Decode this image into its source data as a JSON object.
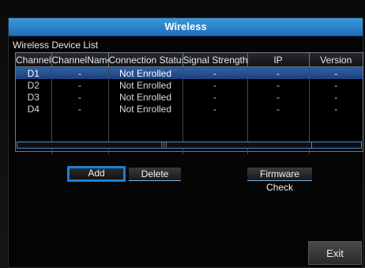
{
  "window": {
    "title": "Wireless"
  },
  "device_list": {
    "label": "Wireless Device List",
    "columns": [
      "Channel",
      "ChannelName",
      "Connection Status",
      "Signal Strength",
      "IP",
      "Version"
    ],
    "rows": [
      [
        "D1",
        "-",
        "Not Enrolled",
        "-",
        "-",
        "-"
      ],
      [
        "D2",
        "-",
        "Not Enrolled",
        "-",
        "-",
        "-"
      ],
      [
        "D3",
        "-",
        "Not Enrolled",
        "-",
        "-",
        "-"
      ],
      [
        "D4",
        "-",
        "Not Enrolled",
        "-",
        "-",
        "-"
      ]
    ],
    "selected_row": 0,
    "scroll_grip": "|||"
  },
  "buttons": {
    "add": "Add",
    "delete": "Delete",
    "firmware": "Firmware Check",
    "exit": "Exit"
  },
  "colors": {
    "accent": "#1a7fd8",
    "title_bar": "#2a86cc",
    "selection": "#2a5597"
  }
}
